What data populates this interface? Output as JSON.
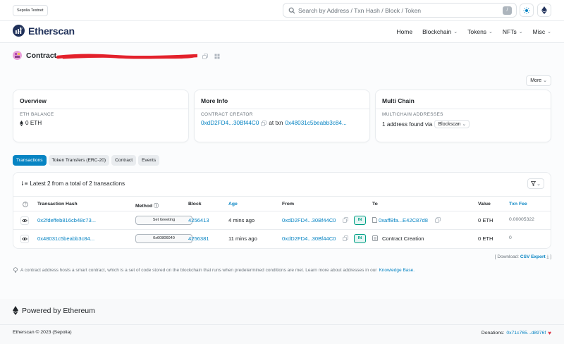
{
  "topbar": {
    "network_badge": "Sepolia Testnet",
    "search_placeholder": "Search by Address / Txn Hash / Block / Token",
    "slash_key": "/"
  },
  "header": {
    "logo_text": "Etherscan",
    "nav": [
      "Home",
      "Blockchain",
      "Tokens",
      "NFTs",
      "Misc"
    ]
  },
  "contract": {
    "title": "Contract",
    "more_label": "More"
  },
  "overview": {
    "title": "Overview",
    "balance_label": "ETH BALANCE",
    "balance_value": "0 ETH"
  },
  "more_info": {
    "title": "More Info",
    "creator_label": "CONTRACT CREATOR",
    "creator_address": "0xdD2FD4...30Bf44C0",
    "at_txn_text": "at txn",
    "creation_txn": "0x48031c5beabb3c84..."
  },
  "multi_chain": {
    "title": "Multi Chain",
    "label": "MULTICHAIN ADDRESSES",
    "value": "1 address found via",
    "provider": "Blockscan"
  },
  "tabs": [
    "Transactions",
    "Token Transfers (ERC-20)",
    "Contract",
    "Events"
  ],
  "transactions": {
    "summary": "Latest 2 from a total of 2 transactions",
    "columns": {
      "hash": "Transaction Hash",
      "method": "Method",
      "block": "Block",
      "age": "Age",
      "from": "From",
      "to": "To",
      "value": "Value",
      "fee": "Txn Fee"
    },
    "rows": [
      {
        "hash": "0x2fdeffeb816cb48c73...",
        "method": "Set Greeting",
        "block": "4256413",
        "age": "4 mins ago",
        "from": "0xdD2FD4...30Bf44C0",
        "direction": "IN",
        "to": "0xaffBfa...E42C87d8",
        "value": "0 ETH",
        "fee": "0.00005322"
      },
      {
        "hash": "0x48031c5beabb3c84...",
        "method": "0x60806040",
        "block": "4256381",
        "age": "11 mins ago",
        "from": "0xdD2FD4...30Bf44C0",
        "direction": "IN",
        "to": "Contract Creation",
        "value": "0 ETH",
        "fee": "0"
      }
    ]
  },
  "download": {
    "prefix": "[ Download:",
    "link": "CSV Export",
    "suffix": "]"
  },
  "note": {
    "text": "A contract address hosts a smart contract, which is a set of code stored on the blockchain that runs when predetermined conditions are met. Learn more about addresses in our",
    "link": "Knowledge Base."
  },
  "footer": {
    "powered": "Powered by Ethereum",
    "copyright": "Etherscan © 2023 (Sepolia)",
    "donations_label": "Donations:",
    "donations_address": "0x71c765...d8976f"
  },
  "colors": {
    "accent": "#0784c3",
    "brand": "#21325b",
    "in_badge": "#00a186",
    "heart": "#dc3545",
    "redaction": "#e3212b"
  }
}
